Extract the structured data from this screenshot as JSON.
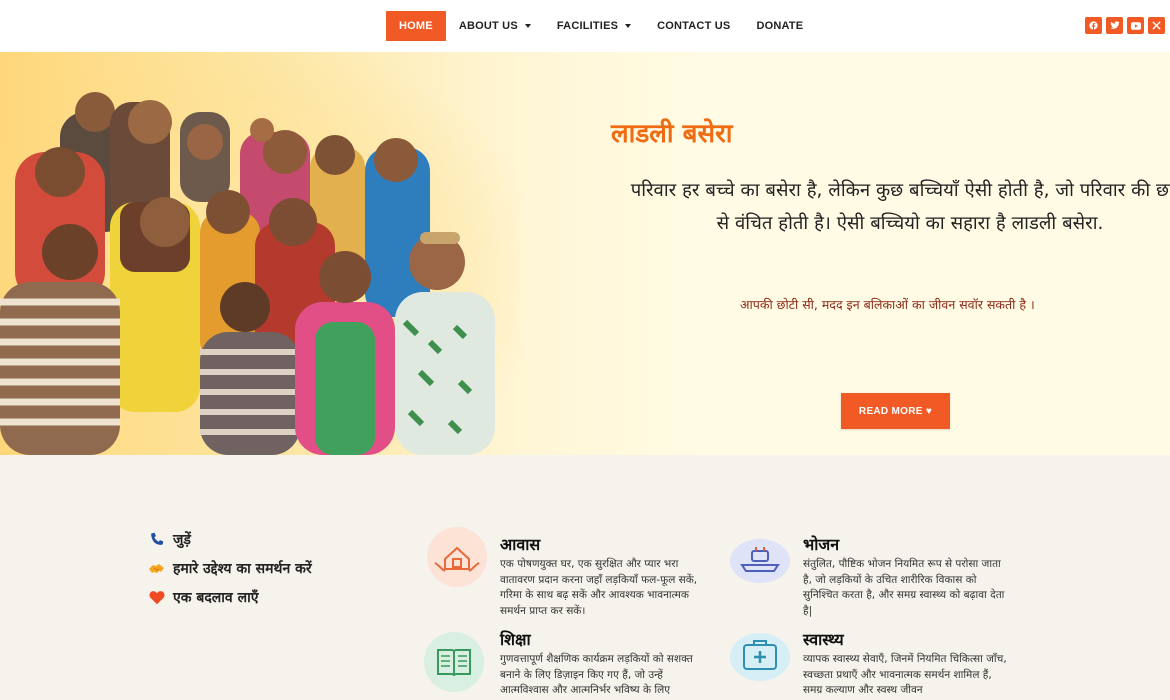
{
  "nav": {
    "items": [
      {
        "label": "HOME",
        "active": true,
        "dropdown": false
      },
      {
        "label": "ABOUT US",
        "active": false,
        "dropdown": true
      },
      {
        "label": "FACILITIES",
        "active": false,
        "dropdown": true
      },
      {
        "label": "CONTACT US",
        "active": false,
        "dropdown": false
      },
      {
        "label": "DONATE",
        "active": false,
        "dropdown": false
      }
    ],
    "social": [
      "facebook-icon",
      "twitter-icon",
      "youtube-icon",
      "x-icon"
    ]
  },
  "hero": {
    "title": "लाडली बसेरा",
    "description_line1": "परिवार हर बच्चे का बसेरा है, लेकिन कुछ बच्चियाँ ऐसी होती है, जो परिवार की छाया",
    "description_line2": "से वंचित होती है। ऐसी बच्चियो का सहारा है लाडली बसेरा.",
    "subtext": "आपकी छोटी सी, मदद इन बलिकाओं का जीवन सवॉर सकती है ।",
    "button_label": "READ MORE ♥"
  },
  "links": [
    {
      "label": "जुड़ें",
      "icon": "phone-icon"
    },
    {
      "label": "हमारे उद्देश्य का समर्थन करें",
      "icon": "handshake-icon"
    },
    {
      "label": "एक बदलाव लाएँ",
      "icon": "heart-icon"
    }
  ],
  "features": [
    {
      "title": "आवास",
      "icon": "house-hands-icon",
      "text": "एक पोषणयुक्त घर, एक सुरक्षित और प्यार भरा वातावरण प्रदान करना जहाँ लड़कियाँ फल-फूल सकें, गरिमा के साथ बढ़ सकें और आवश्यक भावनात्मक समर्थन प्राप्त कर सकें।"
    },
    {
      "title": "भोजन",
      "icon": "food-tray-icon",
      "text": "संतुलित, पौष्टिक भोजन नियमित रूप से परोसा जाता है, जो लड़कियों के उचित शारीरिक विकास को सुनिश्चित करता है, और समग्र स्वास्थ्य को बढ़ावा देता है|"
    },
    {
      "title": "शिक्षा",
      "icon": "book-icon",
      "text": "गुणवत्तापूर्ण शैक्षणिक कार्यक्रम लड़कियों को सशक्त बनाने के लिए डिज़ाइन किए गए हैं, जो उन्हें आत्मविश्वास और आत्मनिर्भर भविष्य के लिए"
    },
    {
      "title": "स्वास्थ्य",
      "icon": "medical-kit-icon",
      "text": "व्यापक स्वास्थ्य सेवाएँ, जिनमें नियमित चिकित्सा जाँच, स्वच्छता प्रथाएँ और भावनात्मक समर्थन शामिल हैं, समग्र कल्याण और स्वस्थ जीवन"
    }
  ]
}
